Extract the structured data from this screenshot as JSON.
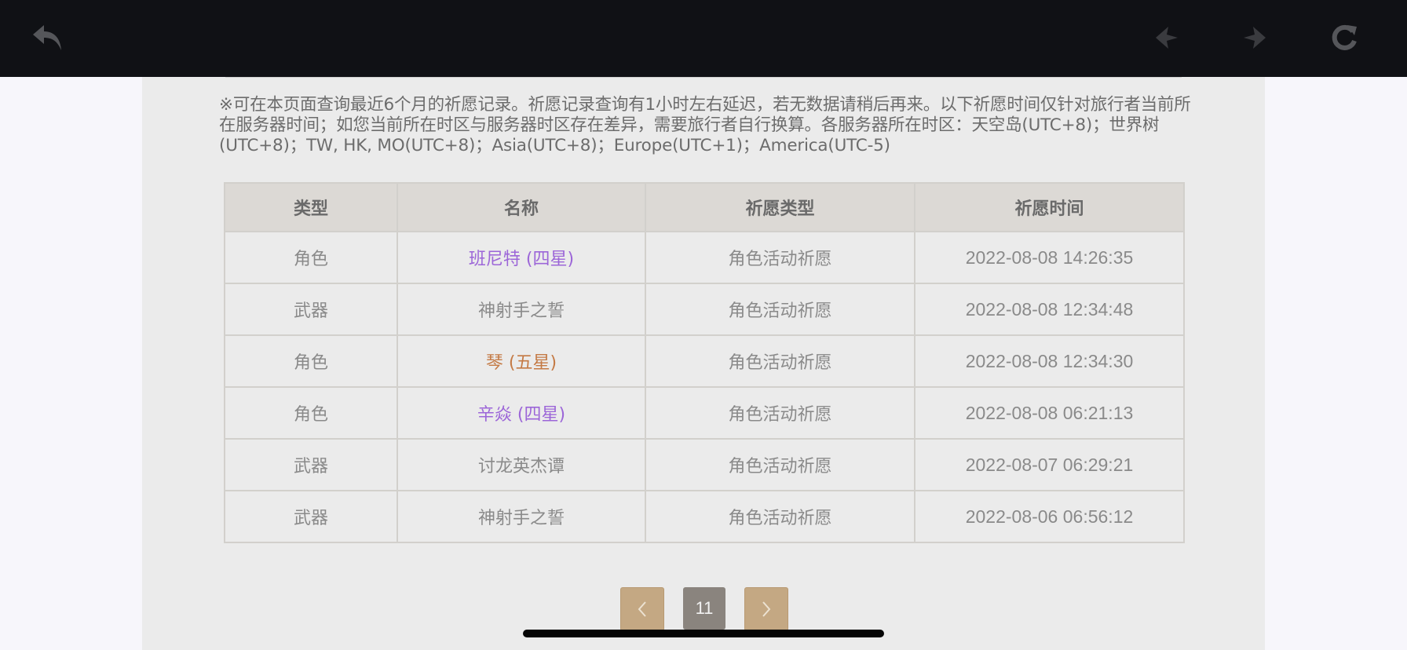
{
  "colors": {
    "topbar": "#101115",
    "page_bg": "#ebebeb",
    "four_star": "#9c66d8",
    "five_star": "#c47a45",
    "default_text": "#8a8a8a",
    "pager_arrow": "#c4a883",
    "pager_current": "#8a847e"
  },
  "toolbar": {
    "icons": [
      "back-icon",
      "previous-icon",
      "next-icon",
      "refresh-icon"
    ]
  },
  "notice": {
    "text": "※可在本页面查询最近6个月的祈愿记录。祈愿记录查询有1小时左右延迟，若无数据请稍后再来。以下祈愿时间仅针对旅行者当前所在服务器时间；如您当前所在时区与服务器时区存在差异，需要旅行者自行换算。各服务器所在时区：天空岛(UTC+8)；世界树(UTC+8)；TW, HK, MO(UTC+8)；Asia(UTC+8)；Europe(UTC+1)；America(UTC-5)"
  },
  "table": {
    "headers": [
      "类型",
      "名称",
      "祈愿类型",
      "祈愿时间"
    ],
    "rows": [
      {
        "type": "角色",
        "name": "班尼特 (四星)",
        "wish_type": "角色活动祈愿",
        "time": "2022-08-08 14:26:35",
        "rarity": "four_star"
      },
      {
        "type": "武器",
        "name": "神射手之誓",
        "wish_type": "角色活动祈愿",
        "time": "2022-08-08 12:34:48",
        "rarity": "default"
      },
      {
        "type": "角色",
        "name": "琴 (五星)",
        "wish_type": "角色活动祈愿",
        "time": "2022-08-08 12:34:30",
        "rarity": "five_star"
      },
      {
        "type": "角色",
        "name": "辛焱 (四星)",
        "wish_type": "角色活动祈愿",
        "time": "2022-08-08 06:21:13",
        "rarity": "four_star"
      },
      {
        "type": "武器",
        "name": "讨龙英杰谭",
        "wish_type": "角色活动祈愿",
        "time": "2022-08-07 06:29:21",
        "rarity": "default"
      },
      {
        "type": "武器",
        "name": "神射手之誓",
        "wish_type": "角色活动祈愿",
        "time": "2022-08-06 06:56:12",
        "rarity": "default"
      }
    ]
  },
  "pagination": {
    "current_page": "11",
    "prev_icon": "chevron-left-icon",
    "next_icon": "chevron-right-icon"
  }
}
